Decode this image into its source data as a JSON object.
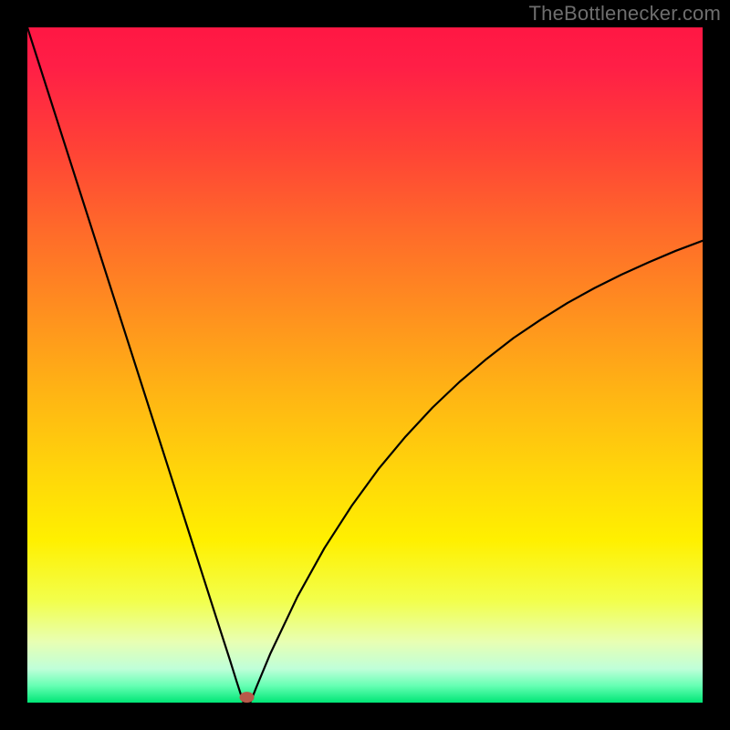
{
  "watermark": "TheBottlenecker.com",
  "chart_data": {
    "type": "line",
    "title": "",
    "xlabel": "",
    "ylabel": "",
    "xlim": [
      0,
      100
    ],
    "ylim": [
      0,
      100
    ],
    "x_optimum": 32,
    "series": [
      {
        "name": "bottleneck-curve",
        "x": [
          0,
          4,
          8,
          12,
          16,
          20,
          24,
          28,
          30,
          31,
          32,
          33,
          34,
          36,
          40,
          44,
          48,
          52,
          56,
          60,
          64,
          68,
          72,
          76,
          80,
          84,
          88,
          92,
          96,
          100
        ],
        "y": [
          100,
          87.5,
          75,
          62.5,
          50,
          37.5,
          25,
          12.5,
          6.3,
          3.1,
          0,
          0,
          2.5,
          7.3,
          15.7,
          22.9,
          29.1,
          34.6,
          39.4,
          43.7,
          47.5,
          50.9,
          54.0,
          56.7,
          59.2,
          61.4,
          63.4,
          65.2,
          66.9,
          68.4
        ]
      }
    ],
    "marker": {
      "x": 32.5,
      "y": 0.8
    },
    "gradient_stops": [
      {
        "offset": 0,
        "color": "#ff1744"
      },
      {
        "offset": 0.06,
        "color": "#ff1f46"
      },
      {
        "offset": 0.18,
        "color": "#ff4236"
      },
      {
        "offset": 0.3,
        "color": "#ff6a2a"
      },
      {
        "offset": 0.42,
        "color": "#ff8f1f"
      },
      {
        "offset": 0.54,
        "color": "#ffb414"
      },
      {
        "offset": 0.66,
        "color": "#ffd60a"
      },
      {
        "offset": 0.76,
        "color": "#fff000"
      },
      {
        "offset": 0.85,
        "color": "#f2ff4d"
      },
      {
        "offset": 0.91,
        "color": "#e8ffb3"
      },
      {
        "offset": 0.95,
        "color": "#bfffd9"
      },
      {
        "offset": 0.975,
        "color": "#66ffb3"
      },
      {
        "offset": 1.0,
        "color": "#00e676"
      }
    ]
  }
}
